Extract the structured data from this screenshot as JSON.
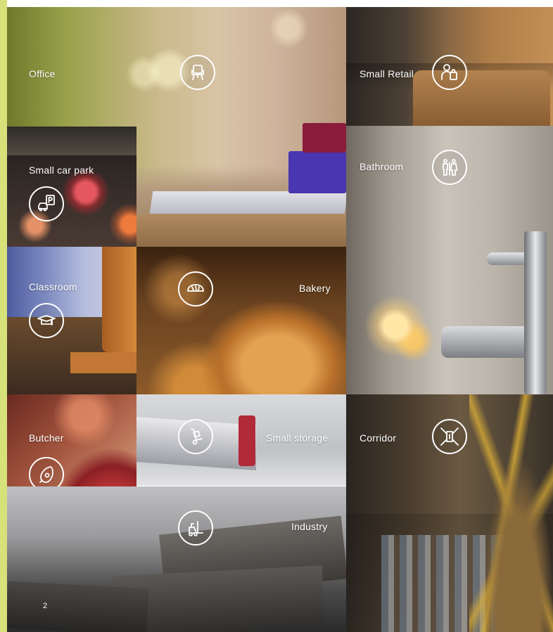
{
  "tiles": {
    "office": {
      "label": "Office",
      "icon": "office-chair-icon"
    },
    "small_retail": {
      "label": "Small Retail",
      "icon": "shopper-bag-icon"
    },
    "small_car_park": {
      "label": "Small car park",
      "icon": "car-parking-icon"
    },
    "bathroom": {
      "label": "Bathroom",
      "icon": "restroom-people-icon"
    },
    "classroom": {
      "label": "Classroom",
      "icon": "graduation-cap-icon"
    },
    "bakery": {
      "label": "Bakery",
      "icon": "bread-icon"
    },
    "butcher": {
      "label": "Butcher",
      "icon": "meat-icon"
    },
    "small_storage": {
      "label": "Small storage",
      "icon": "hand-truck-icon"
    },
    "corridor": {
      "label": "Corridor",
      "icon": "corridor-door-icon"
    },
    "industry": {
      "label": "Industry",
      "icon": "forklift-icon"
    }
  },
  "page_number": "2",
  "colors": {
    "accent_bar": "#d7e17a",
    "text": "#ffffff"
  }
}
